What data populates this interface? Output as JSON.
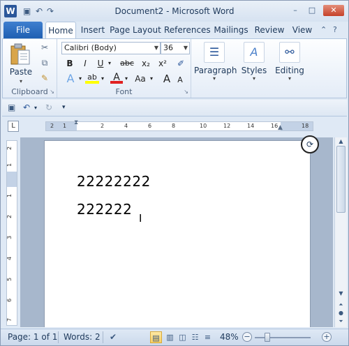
{
  "window": {
    "title": "Document2 - Microsoft Word",
    "app_icon_letter": "W",
    "minimize_icon": "–",
    "maximize_icon": "□",
    "close_icon": "✕"
  },
  "ribbon_tabs": [
    {
      "label": "File"
    },
    {
      "label": "Home"
    },
    {
      "label": "Insert"
    },
    {
      "label": "Page Layout"
    },
    {
      "label": "References"
    },
    {
      "label": "Mailings"
    },
    {
      "label": "Review"
    },
    {
      "label": "View"
    }
  ],
  "clipboard": {
    "paste_label": "Paste",
    "group_label": "Clipboard"
  },
  "font": {
    "name": "Calibri (Body)",
    "size": "36",
    "group_label": "Font",
    "bold": "B",
    "italic": "I",
    "underline": "U",
    "strike": "abc",
    "subscript": "x₂",
    "superscript": "x²",
    "grow": "A",
    "shrink": "A",
    "change_case": "Aa"
  },
  "paragraph": {
    "label": "Paragraph"
  },
  "styles": {
    "label": "Styles"
  },
  "editing": {
    "label": "Editing"
  },
  "ruler": {
    "h_labels": [
      "2",
      "1",
      "2",
      "4",
      "6",
      "8",
      "10",
      "12",
      "14",
      "16",
      "18"
    ],
    "v_labels": [
      "2",
      "1",
      "1",
      "2",
      "3",
      "4",
      "5",
      "6",
      "7"
    ]
  },
  "document": {
    "lines": [
      "22222222",
      "222222"
    ]
  },
  "status": {
    "page": "Page: 1 of 1",
    "words": "Words: 2",
    "zoom": "48%",
    "zoom_minus": "−",
    "zoom_plus": "+"
  },
  "colors": {
    "file_tab": "#1f5fb2",
    "highlight": "#ffff00",
    "font_color": "#e02020"
  }
}
